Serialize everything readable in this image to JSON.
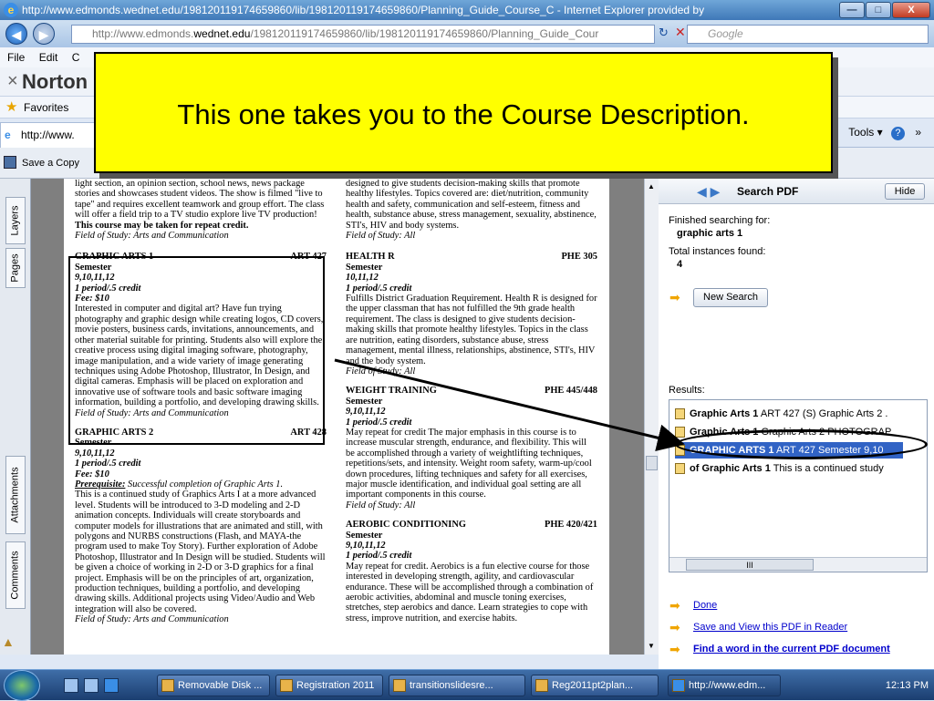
{
  "window": {
    "title": "http://www.edmonds.wednet.edu/198120119174659860/lib/198120119174659860/Planning_Guide_Course_C - Internet Explorer provided by",
    "minimize": "—",
    "maximize": "□",
    "close": "X"
  },
  "address": {
    "url_prefix": "http://www.edmonds.",
    "url_domain": "wednet.edu",
    "url_rest": "/198120119174659860/lib/198120119174659860/Planning_Guide_Cour",
    "search_placeholder": "Google"
  },
  "menu": {
    "items": [
      "File",
      "Edit",
      "C"
    ]
  },
  "norton": {
    "close": "×",
    "label": "Norton"
  },
  "favorites": {
    "label": "Favorites"
  },
  "tab": {
    "label": "http://www.",
    "tools": "Tools ▾"
  },
  "pdfbar": {
    "save": "Save a Copy"
  },
  "callout": {
    "text": "This one takes you to the Course Description."
  },
  "sidebar_tabs": {
    "layers": "Layers",
    "pages": "Pages",
    "attachments": "Attachments",
    "comments": "Comments"
  },
  "doc": {
    "col1_intro": "light section, an opinion section, school news, news package stories and showcases student videos. The show is filmed \"live to tape\" and requires excellent teamwork and group effort. The class will offer a field trip to a TV studio explore live TV production!",
    "col1_intro_bold": "This course may be taken for repeat credit.",
    "col1_intro_field": "Field of Study: Arts and Communication",
    "ga1": {
      "title": "GRAPHIC ARTS 1",
      "code": "ART 427",
      "term": "Semester",
      "grades": "9,10,11,12",
      "credit": "1 period/.5 credit",
      "fee": "Fee: $10",
      "desc": "Interested in computer and digital art? Have fun trying photography and graphic design while creating logos, CD covers, movie posters, business cards, invitations, announcements, and other material suitable for printing. Students also will explore the creative process using digital imaging software, photography, image manipulation, and a wide variety of image generating techniques using Adobe Photoshop, Illustrator, In Design, and digital cameras. Emphasis will be placed on exploration and innovative use of software tools and basic software imaging information, building a portfolio, and developing drawing skills.",
      "field": "Field of Study: Arts and Communication"
    },
    "ga2": {
      "title": "GRAPHIC ARTS 2",
      "code": "ART 428",
      "term": "Semester",
      "grades": "9,10,11,12",
      "credit": "1 period/.5 credit",
      "fee": "Fee: $10",
      "prereq_label": "Prerequisite:",
      "prereq": " Successful completion of Graphic Arts 1.",
      "desc": "This is a continued study of Graphics Arts I at a more advanced level. Students will be introduced to 3-D modeling and 2-D animation concepts. Individuals will create storyboards and computer models for illustrations that are animated and still, with polygons and NURBS constructions (Flash, and MAYA-the program used to make Toy Story). Further exploration of Adobe Photoshop, Illustrator and In Design will be studied. Students will be given a choice of working in 2-D or 3-D graphics for a final project. Emphasis will be on the principles of art, organization, production techniques, building a portfolio, and developing drawing skills. Additional projects using Video/Audio and Web integration will also be covered.",
      "field": "Field of Study: Arts and Communication"
    },
    "col2_intro": "designed to give students decision-making skills that promote healthy lifestyles. Topics covered are: diet/nutrition, community health and safety, communication and self-esteem, fitness and health, substance abuse, stress management, sexuality, abstinence, STI's, HIV and body systems.",
    "col2_intro_field": "Field of Study: All",
    "health": {
      "title": "HEALTH R",
      "code": "PHE 305",
      "term": "Semester",
      "grades": "10,11,12",
      "credit": "1 period/.5 credit",
      "desc": "Fulfills District Graduation Requirement. Health R is designed for the upper classman that has not fulfilled the 9th grade health requirement. The class is designed to give students decision-making skills that promote healthy lifestyles. Topics in the class are nutrition, eating disorders, substance abuse, stress management, mental illness, relationships, abstinence, STI's, HIV and the body system.",
      "field": "Field of Study: All"
    },
    "weight": {
      "title": "WEIGHT TRAINING",
      "code": "PHE 445/448",
      "term": "Semester",
      "grades": "9,10,11,12",
      "credit": "1 period/.5 credit",
      "desc": "May repeat for credit The major emphasis in this course is to increase muscular strength, endurance, and flexibility. This will be accomplished through a variety of weightlifting techniques, repetitions/sets, and intensity. Weight room safety, warm-up/cool down procedures, lifting techniques and safety for all exercises, major muscle identification, and individual goal setting are all important components in this course.",
      "field": "Field of Study: All"
    },
    "aerobic": {
      "title": "AEROBIC CONDITIONING",
      "code": "PHE 420/421",
      "term": "Semester",
      "grades": "9,10,11,12",
      "credit": "1 period/.5 credit",
      "desc": "May repeat for credit. Aerobics is a fun elective course for those interested in developing strength, agility, and cardiovascular endurance. These will be accomplished through a combination of aerobic activities, abdominal and muscle toning exercises, stretches, step aerobics and dance. Learn strategies to cope with stress, improve nutrition, and exercise habits."
    }
  },
  "search": {
    "header": "Search PDF",
    "hide": "Hide",
    "finished_label": "Finished searching for:",
    "term": "graphic arts 1",
    "total_label": "Total instances found:",
    "total": "4",
    "new_search": "New Search",
    "results_label": "Results:",
    "results": [
      {
        "bold": "Graphic Arts 1",
        "rest": " ART 427 (S) Graphic Arts 2 ."
      },
      {
        "bold": "Graphic Arts 1",
        "rest": " Graphic Arts 2 PHOTOGRAP"
      },
      {
        "bold": "GRAPHIC ARTS 1",
        "rest": " ART 427 Semester 9,10"
      },
      {
        "bold": "of Graphic Arts 1",
        "rest": " This is a continued study"
      }
    ],
    "scroll_label": "III",
    "done": "Done",
    "save_view": "Save and View this PDF in Reader",
    "find_word": "Find a word in the current PDF document"
  },
  "taskbar": {
    "items": [
      "Removable Disk ...",
      "Registration 2011",
      "transitionslidesre...",
      "Reg2011pt2plan...",
      "http://www.edm..."
    ],
    "clock": "12:13 PM"
  }
}
